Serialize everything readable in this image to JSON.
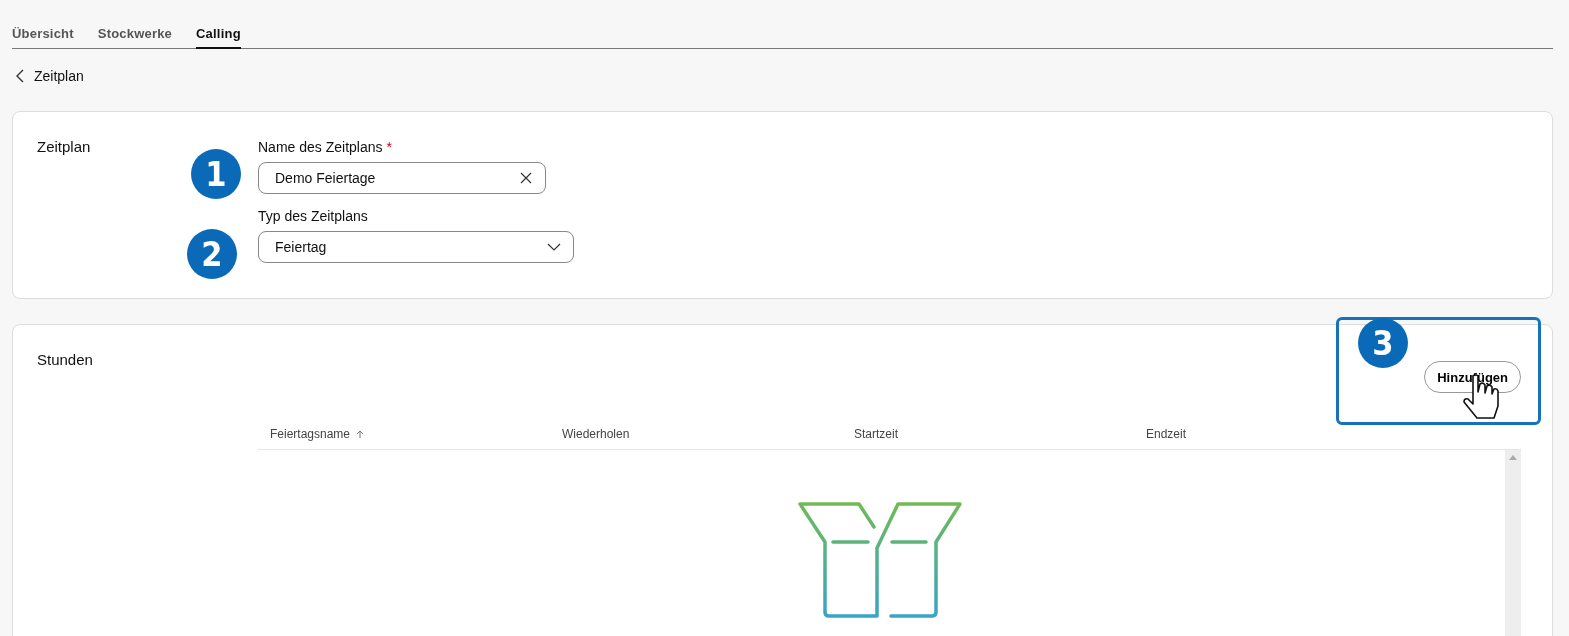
{
  "tabs": [
    {
      "label": "Übersicht",
      "selected": false
    },
    {
      "label": "Stockwerke",
      "selected": false
    },
    {
      "label": "Calling",
      "selected": true
    }
  ],
  "breadcrumb": {
    "label": "Zeitplan"
  },
  "schedule_card": {
    "title": "Zeitplan",
    "fields": [
      {
        "kind": "text",
        "label": "Name des Zeitplans",
        "required_mark": "*",
        "value": "Demo Feiertage",
        "callout": "1"
      },
      {
        "kind": "select",
        "label": "Typ des Zeitplans",
        "value": "Feiertag",
        "callout": "2"
      }
    ]
  },
  "hours_card": {
    "title": "Stunden",
    "add_button": "Hinzufügen",
    "callout": "3",
    "table": {
      "columns": [
        {
          "label": "Feiertagsname",
          "sorted": true
        },
        {
          "label": "Wiederholen",
          "sorted": false
        },
        {
          "label": "Startzeit",
          "sorted": false
        },
        {
          "label": "Endzeit",
          "sorted": false
        }
      ]
    }
  }
}
